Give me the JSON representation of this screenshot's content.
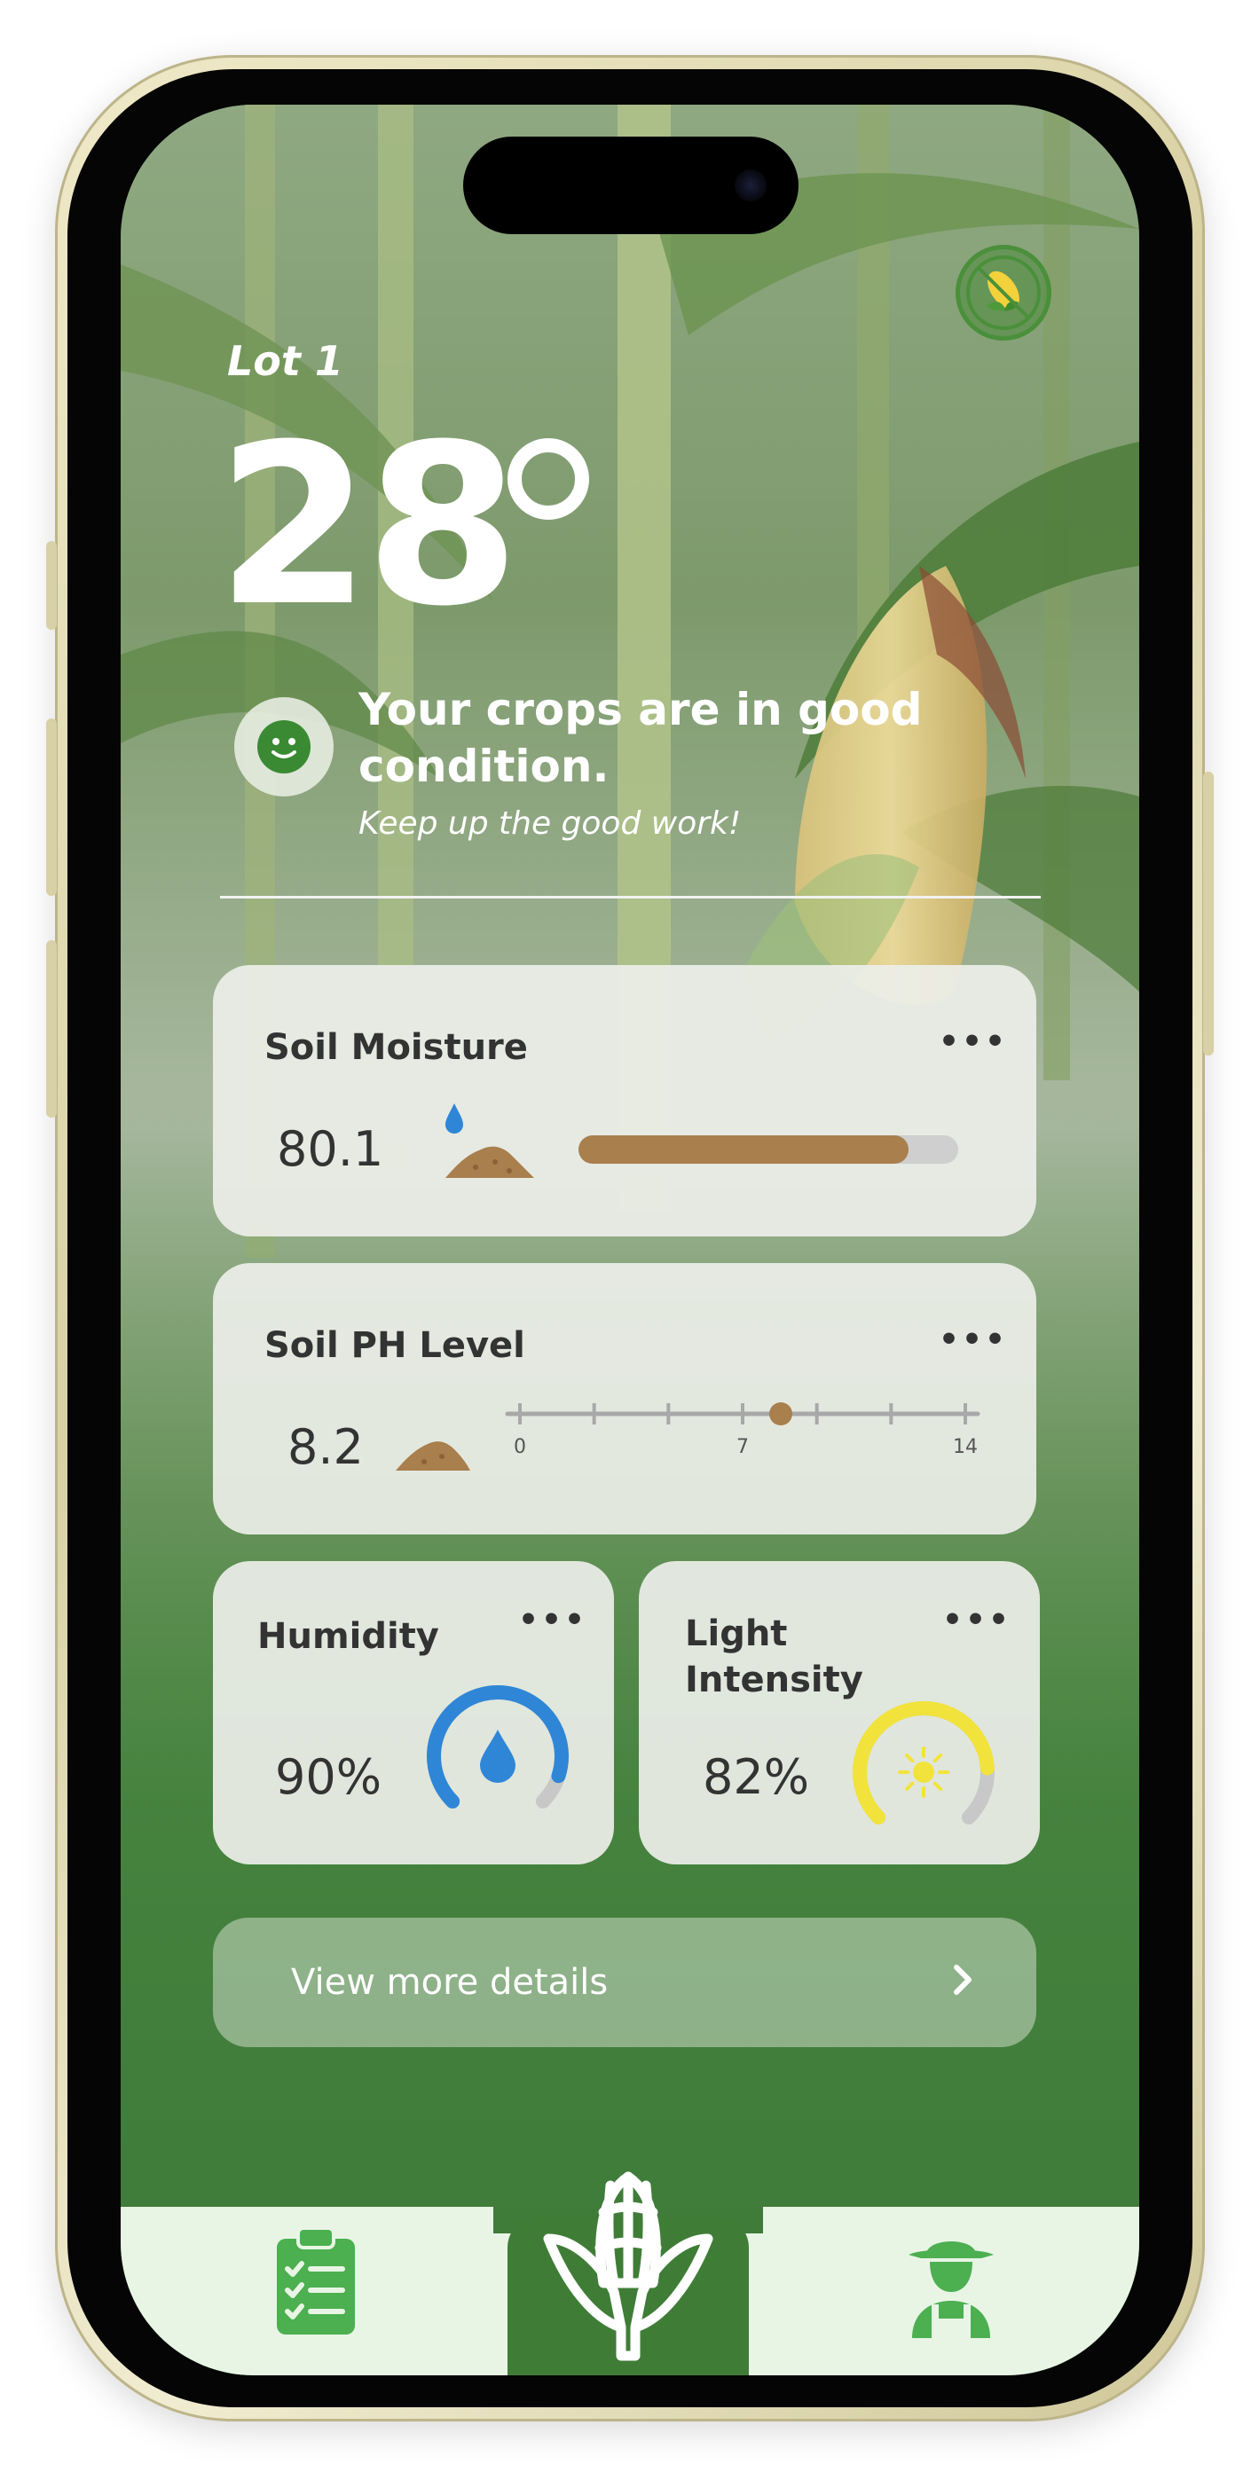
{
  "header": {
    "lot_title": "Lot 1",
    "temperature": "28",
    "status_title": "Your crops are in good condition.",
    "status_subtitle": "Keep up the good work!"
  },
  "soil_moisture": {
    "title": "Soil Moisture",
    "more": "•••",
    "value": "80.1",
    "level_fraction": 0.87
  },
  "soil_ph": {
    "title": "Soil PH Level",
    "more": "•••",
    "value": "8.2",
    "tick_labels": [
      "0",
      "7",
      "14"
    ],
    "min": 0,
    "max": 14,
    "marker_value": 8.2
  },
  "humidity": {
    "title": "Humidity",
    "more": "•••",
    "value": "90%",
    "level_fraction": 0.9
  },
  "light": {
    "title": "Light Intensity",
    "title_line1": "Light",
    "title_line2": "Intensity",
    "more": "•••",
    "value": "82%",
    "level_fraction": 0.82
  },
  "details_button": {
    "label": "View more details"
  },
  "tabbar": {
    "tabs": [
      {
        "icon": "clipboard-checklist-icon"
      },
      {
        "icon": "corn-icon"
      },
      {
        "icon": "farmer-icon"
      }
    ]
  },
  "colors": {
    "brand_green": "#3f7d37",
    "soil_brown": "#a97f4d",
    "water_blue": "#2f86d6",
    "sun_yellow": "#f2e33c",
    "track_gray": "#c8c8c8",
    "tabbar_bg": "#e8f5e5"
  }
}
